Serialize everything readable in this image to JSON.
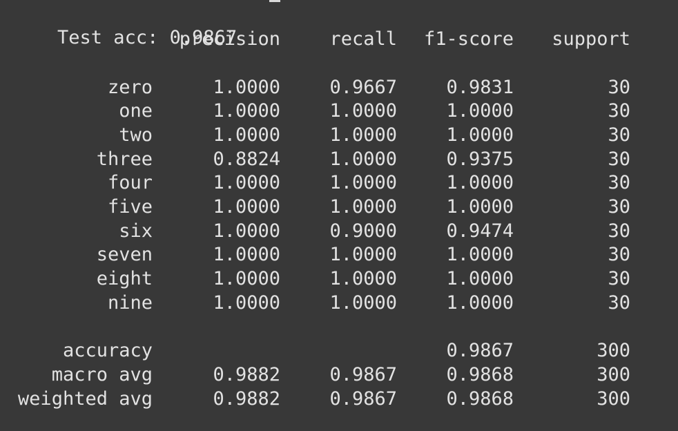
{
  "header": {
    "test_acc": "Test acc: 0.9867"
  },
  "columns": {
    "precision": "precision",
    "recall": "recall",
    "f1": "f1-score",
    "support": "support"
  },
  "rows": [
    {
      "label": "zero",
      "precision": "1.0000",
      "recall": "0.9667",
      "f1": "0.9831",
      "support": "30"
    },
    {
      "label": "one",
      "precision": "1.0000",
      "recall": "1.0000",
      "f1": "1.0000",
      "support": "30"
    },
    {
      "label": "two",
      "precision": "1.0000",
      "recall": "1.0000",
      "f1": "1.0000",
      "support": "30"
    },
    {
      "label": "three",
      "precision": "0.8824",
      "recall": "1.0000",
      "f1": "0.9375",
      "support": "30"
    },
    {
      "label": "four",
      "precision": "1.0000",
      "recall": "1.0000",
      "f1": "1.0000",
      "support": "30"
    },
    {
      "label": "five",
      "precision": "1.0000",
      "recall": "1.0000",
      "f1": "1.0000",
      "support": "30"
    },
    {
      "label": "six",
      "precision": "1.0000",
      "recall": "0.9000",
      "f1": "0.9474",
      "support": "30"
    },
    {
      "label": "seven",
      "precision": "1.0000",
      "recall": "1.0000",
      "f1": "1.0000",
      "support": "30"
    },
    {
      "label": "eight",
      "precision": "1.0000",
      "recall": "1.0000",
      "f1": "1.0000",
      "support": "30"
    },
    {
      "label": "nine",
      "precision": "1.0000",
      "recall": "1.0000",
      "f1": "1.0000",
      "support": "30"
    }
  ],
  "summary": [
    {
      "label": "accuracy",
      "precision": "",
      "recall": "",
      "f1": "0.9867",
      "support": "300"
    },
    {
      "label": "macro avg",
      "precision": "0.9882",
      "recall": "0.9867",
      "f1": "0.9868",
      "support": "300"
    },
    {
      "label": "weighted avg",
      "precision": "0.9882",
      "recall": "0.9867",
      "f1": "0.9868",
      "support": "300"
    }
  ],
  "theme": {
    "background": "#383838",
    "foreground": "#e2e2e2"
  }
}
